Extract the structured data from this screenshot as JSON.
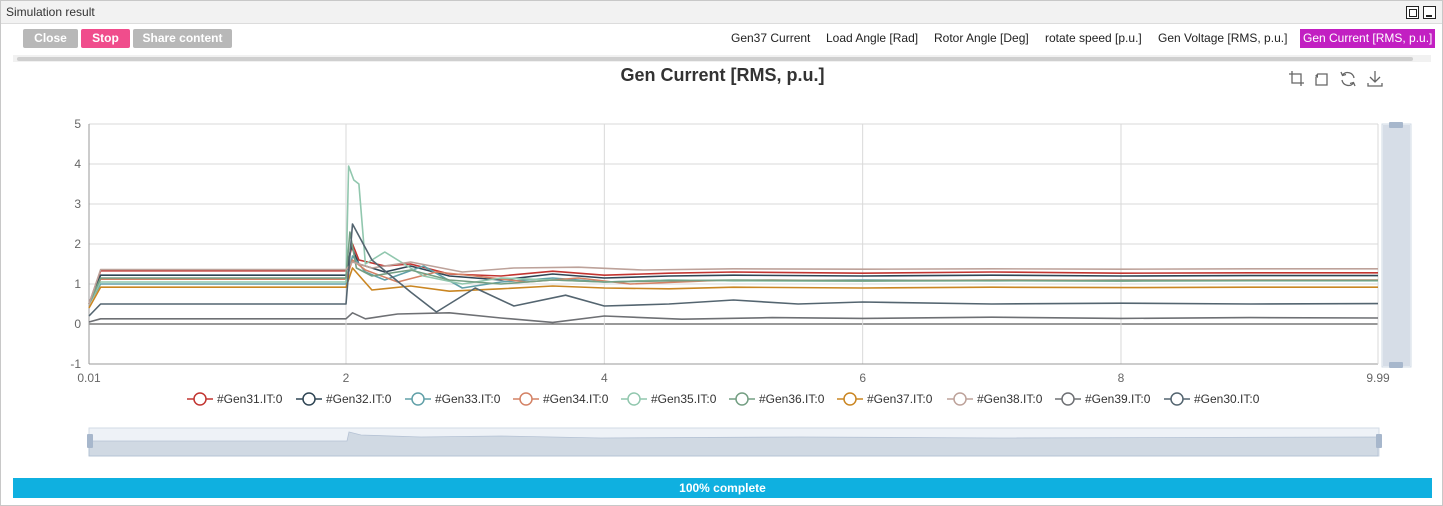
{
  "window": {
    "title": "Simulation result"
  },
  "toolbar": {
    "close_label": "Close",
    "stop_label": "Stop",
    "share_label": "Share content"
  },
  "tabs": [
    {
      "label": "Gen37 Current",
      "active": false
    },
    {
      "label": "Load Angle [Rad]",
      "active": false
    },
    {
      "label": "Rotor Angle [Deg]",
      "active": false
    },
    {
      "label": "rotate speed [p.u.]",
      "active": false
    },
    {
      "label": "Gen Voltage [RMS, p.u.]",
      "active": false
    },
    {
      "label": "Gen Current [RMS, p.u.]",
      "active": true
    }
  ],
  "progress": {
    "value": 100,
    "label": "100% complete"
  },
  "icons": {
    "zoom": "zoom-icon",
    "zoom_reset": "zoom-reset-icon",
    "restore": "restore-icon",
    "save": "save-image-icon"
  },
  "chart_data": {
    "type": "line",
    "title": "Gen Current [RMS, p.u.]",
    "xlabel": "",
    "ylabel": "",
    "xlim": [
      0.01,
      9.99
    ],
    "ylim": [
      -1,
      5
    ],
    "x_ticks": [
      "0.01",
      "2",
      "4",
      "6",
      "8",
      "9.99"
    ],
    "x_tick_values": [
      0.01,
      2,
      4,
      6,
      8,
      9.99
    ],
    "y_ticks": [
      "-1",
      "0",
      "1",
      "2",
      "3",
      "4",
      "5"
    ],
    "grid": true,
    "legend_position": "bottom",
    "datazoom": {
      "start": 0,
      "end": 100
    },
    "series": [
      {
        "name": "#Gen31.IT:0",
        "color": "#c23531",
        "x": [
          0.01,
          0.1,
          2.0,
          2.05,
          2.1,
          2.3,
          2.5,
          2.8,
          3.2,
          3.6,
          4.0,
          4.5,
          5.0,
          6.0,
          7.0,
          8.0,
          9.0,
          9.99
        ],
        "y": [
          0.5,
          1.33,
          1.33,
          2.0,
          1.6,
          1.45,
          1.5,
          1.25,
          1.2,
          1.32,
          1.22,
          1.27,
          1.3,
          1.27,
          1.3,
          1.27,
          1.28,
          1.28
        ]
      },
      {
        "name": "#Gen32.IT:0",
        "color": "#2f4554",
        "x": [
          0.01,
          0.1,
          2.0,
          2.04,
          2.1,
          2.3,
          2.5,
          2.8,
          3.2,
          3.6,
          4.0,
          4.5,
          5.0,
          6.0,
          7.0,
          8.0,
          9.0,
          9.99
        ],
        "y": [
          0.5,
          1.22,
          1.22,
          1.95,
          1.5,
          1.3,
          1.45,
          1.2,
          1.1,
          1.25,
          1.15,
          1.2,
          1.22,
          1.2,
          1.22,
          1.2,
          1.21,
          1.21
        ]
      },
      {
        "name": "#Gen33.IT:0",
        "color": "#61a0a8",
        "x": [
          0.01,
          0.1,
          2.0,
          2.05,
          2.15,
          2.3,
          2.6,
          2.9,
          3.2,
          3.6,
          4.0,
          4.5,
          5.0,
          6.0,
          7.0,
          8.0,
          9.0,
          9.99
        ],
        "y": [
          0.5,
          1.0,
          1.0,
          1.7,
          1.3,
          1.1,
          1.45,
          0.9,
          1.05,
          1.15,
          1.05,
          1.1,
          1.08,
          1.1,
          1.08,
          1.1,
          1.09,
          1.09
        ]
      },
      {
        "name": "#Gen34.IT:0",
        "color": "#d48265",
        "x": [
          0.01,
          0.1,
          2.0,
          2.05,
          2.15,
          2.4,
          2.7,
          3.0,
          3.4,
          3.8,
          4.2,
          4.8,
          5.3,
          6.0,
          7.0,
          8.0,
          9.0,
          9.99
        ],
        "y": [
          0.5,
          1.12,
          1.12,
          1.6,
          1.35,
          1.05,
          1.3,
          1.2,
          1.05,
          1.15,
          1.0,
          1.08,
          1.1,
          1.08,
          1.1,
          1.09,
          1.1,
          1.1
        ]
      },
      {
        "name": "#Gen35.IT:0",
        "color": "#91c7ae",
        "x": [
          0.01,
          0.1,
          2.0,
          2.02,
          2.06,
          2.1,
          2.15,
          2.3,
          2.6,
          2.9,
          3.2,
          3.6,
          4.0,
          4.5,
          5.0,
          6.0,
          7.0,
          8.0,
          9.0,
          9.99
        ],
        "y": [
          0.5,
          1.05,
          1.05,
          3.95,
          3.6,
          3.5,
          1.5,
          1.8,
          1.2,
          1.0,
          1.15,
          1.1,
          1.05,
          1.1,
          1.08,
          1.07,
          1.08,
          1.07,
          1.08,
          1.08
        ]
      },
      {
        "name": "#Gen36.IT:0",
        "color": "#749f83",
        "x": [
          0.01,
          0.1,
          2.0,
          2.03,
          2.08,
          2.2,
          2.5,
          2.8,
          3.2,
          3.6,
          4.0,
          4.5,
          5.0,
          6.0,
          7.0,
          8.0,
          9.0,
          9.99
        ],
        "y": [
          0.5,
          1.15,
          1.15,
          2.3,
          1.4,
          1.2,
          1.35,
          1.1,
          1.0,
          1.1,
          1.05,
          1.08,
          1.1,
          1.08,
          1.09,
          1.08,
          1.09,
          1.09
        ]
      },
      {
        "name": "#Gen37.IT:0",
        "color": "#ca8622",
        "x": [
          0.01,
          0.1,
          2.0,
          2.05,
          2.2,
          2.5,
          2.8,
          3.2,
          3.6,
          4.0,
          4.5,
          5.0,
          6.0,
          7.0,
          8.0,
          9.0,
          9.99
        ],
        "y": [
          0.4,
          0.92,
          0.92,
          1.4,
          0.85,
          0.95,
          0.82,
          0.88,
          0.95,
          0.9,
          0.88,
          0.92,
          0.9,
          0.92,
          0.91,
          0.92,
          0.92
        ]
      },
      {
        "name": "#Gen38.IT:0",
        "color": "#bda29a",
        "x": [
          0.01,
          0.1,
          2.0,
          2.05,
          2.2,
          2.5,
          2.9,
          3.3,
          3.8,
          4.3,
          5.0,
          6.0,
          7.0,
          8.0,
          9.0,
          9.99
        ],
        "y": [
          0.5,
          1.36,
          1.36,
          1.55,
          1.4,
          1.55,
          1.3,
          1.4,
          1.42,
          1.35,
          1.38,
          1.37,
          1.38,
          1.37,
          1.38,
          1.38
        ]
      },
      {
        "name": "#Gen39.IT:0",
        "color": "#6e7074",
        "x": [
          0.01,
          0.1,
          2.0,
          2.05,
          2.15,
          2.4,
          2.8,
          3.2,
          3.6,
          4.0,
          4.6,
          5.3,
          6.0,
          7.0,
          8.0,
          9.0,
          9.99
        ],
        "y": [
          0.05,
          0.13,
          0.13,
          0.28,
          0.13,
          0.25,
          0.28,
          0.15,
          0.04,
          0.2,
          0.12,
          0.16,
          0.14,
          0.17,
          0.14,
          0.16,
          0.15
        ]
      },
      {
        "name": "#Gen30.IT:0",
        "color": "#546570",
        "x": [
          0.01,
          0.1,
          2.0,
          2.05,
          2.2,
          2.5,
          2.7,
          3.0,
          3.3,
          3.7,
          4.0,
          4.5,
          5.0,
          5.5,
          6.0,
          7.0,
          8.0,
          9.0,
          9.99
        ],
        "y": [
          0.2,
          0.5,
          0.5,
          2.5,
          1.6,
          0.8,
          0.3,
          0.9,
          0.45,
          0.72,
          0.45,
          0.5,
          0.6,
          0.5,
          0.55,
          0.5,
          0.52,
          0.5,
          0.51
        ]
      }
    ]
  }
}
